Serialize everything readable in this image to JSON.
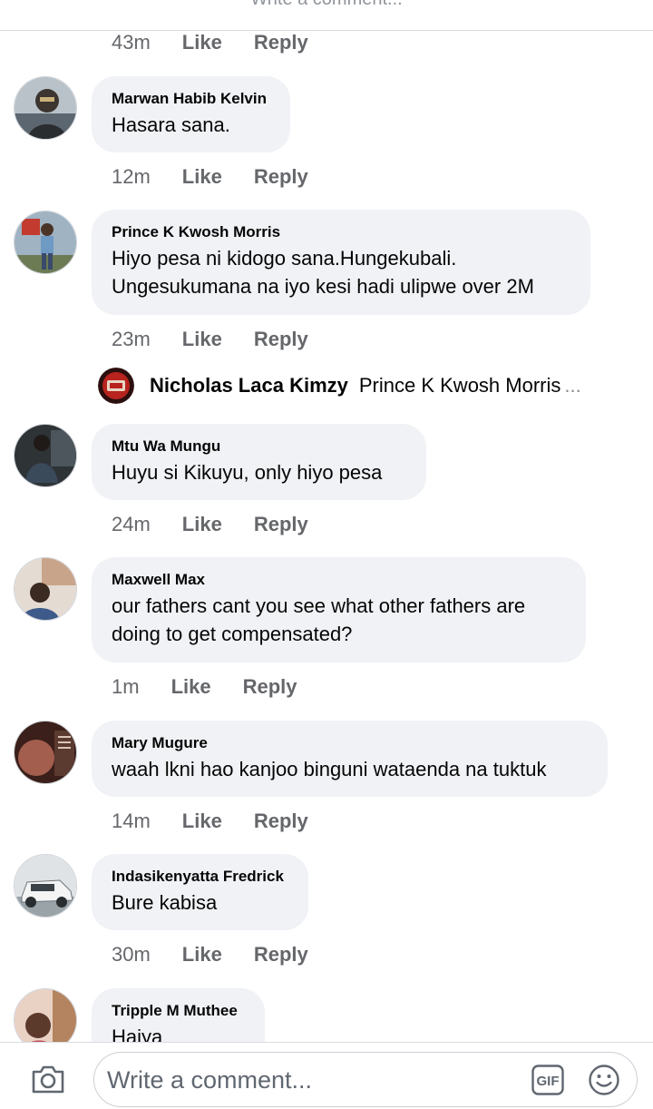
{
  "header": {
    "cut_title": "Write a comment..."
  },
  "top_meta": {
    "time": "43m",
    "like": "Like",
    "reply": "Reply"
  },
  "comments": [
    {
      "author": "Marwan Habib Kelvin",
      "text": "Hasara sana.",
      "time": "12m",
      "like": "Like",
      "reply": "Reply",
      "avatar_color": "#4a5560"
    },
    {
      "author": "Prince K Kwosh Morris",
      "text": "Hiyo pesa ni kidogo sana.Hungekubali. Ungesukumana na iyo kesi hadi ulipwe over 2M",
      "time": "23m",
      "like": "Like",
      "reply": "Reply",
      "avatar_color": "#7a8c9a"
    },
    {
      "author": "Mtu Wa Mungu",
      "text": "Huyu si Kikuyu, only hiyo pesa",
      "time": "24m",
      "like": "Like",
      "reply": "Reply",
      "avatar_color": "#3b4448"
    },
    {
      "author": "Maxwell Max",
      "text": "our fathers cant you see what other fathers are doing to get compensated?",
      "time": "1m",
      "like": "Like",
      "reply": "Reply",
      "avatar_color": "#c7b8a8"
    },
    {
      "author": "Mary Mugure",
      "text": "waah lkni hao kanjoo binguni wataenda na tuktuk",
      "time": "14m",
      "like": "Like",
      "reply": "Reply",
      "avatar_color": "#8a4a3c"
    },
    {
      "author": "Indasikenyatta Fredrick",
      "text": "Bure kabisa",
      "time": "30m",
      "like": "Like",
      "reply": "Reply",
      "avatar_color": "#9aa3a8"
    },
    {
      "author": "Tripple M Muthee",
      "text": "Haiya",
      "avatar_color": "#c04a5a"
    }
  ],
  "reply_preview": {
    "name": "Nicholas Laca Kimzy",
    "text": "Prince K Kwosh Morris",
    "ellipsis": "...",
    "avatar_color": "#b8231e"
  },
  "composer": {
    "placeholder": "Write a comment...",
    "gif_label": "GIF",
    "camera_icon": "camera-icon",
    "emoji_icon": "emoji-icon"
  },
  "colors": {
    "bubble": "#f0f2f5",
    "meta": "#65676b",
    "text": "#050505"
  }
}
